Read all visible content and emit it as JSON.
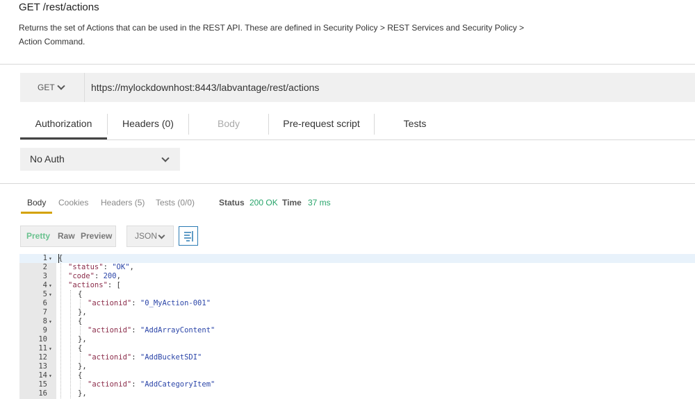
{
  "header": {
    "title": "GET /rest/actions",
    "description": "Returns the set of Actions that can be used in the REST API. These are defined in Security Policy > REST Services and Security Policy > Action Command."
  },
  "request": {
    "method": "GET",
    "url": "https://mylockdownhost:8443/labvantage/rest/actions",
    "tabs": [
      "Authorization",
      "Headers (0)",
      "Body",
      "Pre-request script",
      "Tests"
    ],
    "active_tab": "Authorization",
    "auth_type": "No Auth"
  },
  "response": {
    "tabs": [
      "Body",
      "Cookies",
      "Headers (5)",
      "Tests (0/0)"
    ],
    "active_tab": "Body",
    "status_label": "Status",
    "status_value": "200 OK",
    "time_label": "Time",
    "time_value": "37 ms",
    "view_modes": [
      "Pretty",
      "Raw",
      "Preview"
    ],
    "active_view": "Pretty",
    "format": "JSON",
    "code_lines": [
      {
        "n": "1",
        "fold": true,
        "indent": 0,
        "parts": [
          [
            "p",
            "{"
          ]
        ]
      },
      {
        "n": "2",
        "fold": false,
        "indent": 1,
        "parts": [
          [
            "k",
            "\"status\""
          ],
          [
            "p",
            ": "
          ],
          [
            "s",
            "\"OK\""
          ],
          [
            "p",
            ","
          ]
        ]
      },
      {
        "n": "3",
        "fold": false,
        "indent": 1,
        "parts": [
          [
            "k",
            "\"code\""
          ],
          [
            "p",
            ": "
          ],
          [
            "n",
            "200"
          ],
          [
            "p",
            ","
          ]
        ]
      },
      {
        "n": "4",
        "fold": true,
        "indent": 1,
        "parts": [
          [
            "k",
            "\"actions\""
          ],
          [
            "p",
            ": ["
          ]
        ]
      },
      {
        "n": "5",
        "fold": true,
        "indent": 2,
        "parts": [
          [
            "p",
            "{"
          ]
        ]
      },
      {
        "n": "6",
        "fold": false,
        "indent": 3,
        "parts": [
          [
            "k",
            "\"actionid\""
          ],
          [
            "p",
            ": "
          ],
          [
            "s",
            "\"0_MyAction-001\""
          ]
        ]
      },
      {
        "n": "7",
        "fold": false,
        "indent": 2,
        "parts": [
          [
            "p",
            "},"
          ]
        ]
      },
      {
        "n": "8",
        "fold": true,
        "indent": 2,
        "parts": [
          [
            "p",
            "{"
          ]
        ]
      },
      {
        "n": "9",
        "fold": false,
        "indent": 3,
        "parts": [
          [
            "k",
            "\"actionid\""
          ],
          [
            "p",
            ": "
          ],
          [
            "s",
            "\"AddArrayContent\""
          ]
        ]
      },
      {
        "n": "10",
        "fold": false,
        "indent": 2,
        "parts": [
          [
            "p",
            "},"
          ]
        ]
      },
      {
        "n": "11",
        "fold": true,
        "indent": 2,
        "parts": [
          [
            "p",
            "{"
          ]
        ]
      },
      {
        "n": "12",
        "fold": false,
        "indent": 3,
        "parts": [
          [
            "k",
            "\"actionid\""
          ],
          [
            "p",
            ": "
          ],
          [
            "s",
            "\"AddBucketSDI\""
          ]
        ]
      },
      {
        "n": "13",
        "fold": false,
        "indent": 2,
        "parts": [
          [
            "p",
            "},"
          ]
        ]
      },
      {
        "n": "14",
        "fold": true,
        "indent": 2,
        "parts": [
          [
            "p",
            "{"
          ]
        ]
      },
      {
        "n": "15",
        "fold": false,
        "indent": 3,
        "parts": [
          [
            "k",
            "\"actionid\""
          ],
          [
            "p",
            ": "
          ],
          [
            "s",
            "\"AddCategoryItem\""
          ]
        ]
      },
      {
        "n": "16",
        "fold": false,
        "indent": 2,
        "parts": [
          [
            "p",
            "},"
          ]
        ]
      }
    ]
  }
}
